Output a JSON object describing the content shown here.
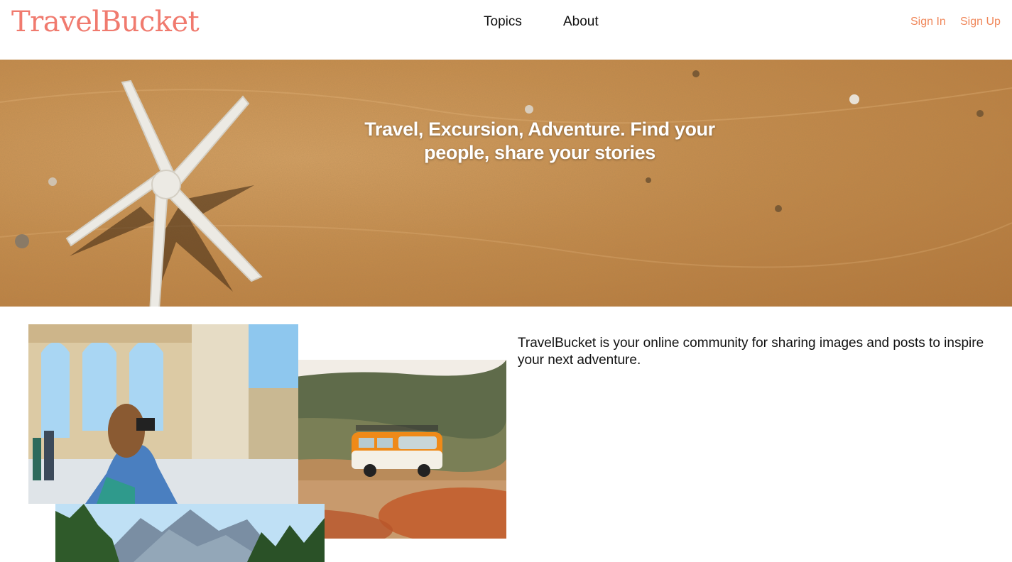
{
  "header": {
    "brand": "TravelBucket",
    "nav": [
      {
        "label": "Topics"
      },
      {
        "label": "About"
      }
    ],
    "auth": {
      "sign_in": "Sign In",
      "sign_up": "Sign Up"
    }
  },
  "hero": {
    "tagline": "Travel, Excursion, Adventure. Find your people, share your stories"
  },
  "main": {
    "description": "TravelBucket is your online community for sharing images and posts to inspire your next adventure."
  },
  "colors": {
    "brand": "#f07a6e",
    "auth_link": "#f0875a",
    "sand": "#c98f4f"
  }
}
